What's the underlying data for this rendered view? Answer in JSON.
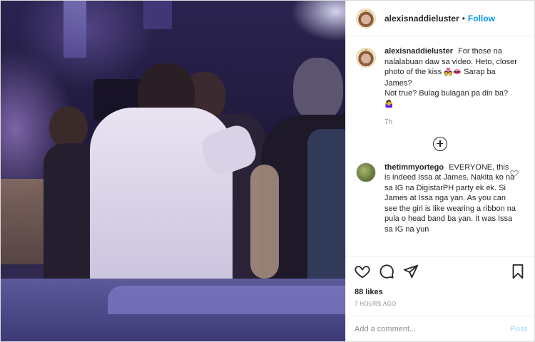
{
  "header": {
    "username": "alexisnaddieluster",
    "separator": "•",
    "follow_label": "Follow"
  },
  "caption": {
    "username": "alexisnaddieluster",
    "text_1": "For those na nalalabuan daw sa video. Heto, closer photo of the kiss",
    "emoji_1": "💑👄",
    "text_2": "Sarap ba James?",
    "text_3": "Not true? Bulag bulagan pa din ba?",
    "emoji_2": "🤷‍♀️",
    "time": "7h"
  },
  "comments": [
    {
      "username": "thetimmyortego",
      "text": "EVERYONE, this is indeed Issa at James. Nakita ko na sa IG na DigistarPH party ek ek. Si James at Issa nga yan. As you can see the girl is like wearing a ribbon na pula o head band ba yan. It was Issa sa IG na yun"
    }
  ],
  "actions": {
    "likes": "88 likes",
    "posted_ago": "7 HOURS AGO"
  },
  "comment_box": {
    "placeholder": "Add a comment...",
    "post_label": "Post"
  },
  "colors": {
    "accent": "#0095f6",
    "post_disabled": "#b2dffc",
    "muted": "#8e8e8e"
  },
  "icons": [
    "more-icon",
    "heart-icon",
    "comment-icon",
    "share-icon",
    "bookmark-icon",
    "add-comments-icon"
  ]
}
